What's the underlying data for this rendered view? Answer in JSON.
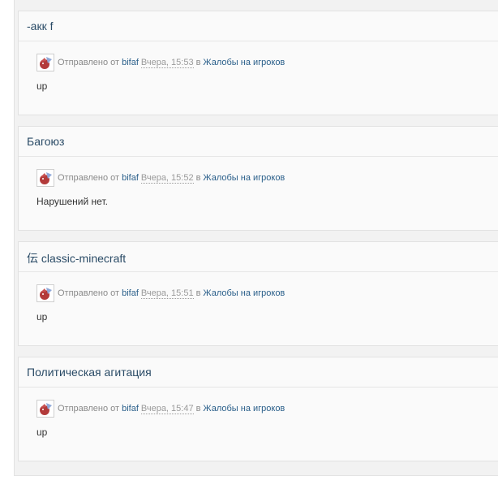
{
  "posts": [
    {
      "title": "-акк f",
      "sent_by": "Отправлено от",
      "author": "bifaf",
      "date": "Вчера, 15:53",
      "in_word": "в",
      "forum": "Жалобы на игроков",
      "body": "up"
    },
    {
      "title": "Багоюз",
      "sent_by": "Отправлено от",
      "author": "bifaf",
      "date": "Вчера, 15:52",
      "in_word": "в",
      "forum": "Жалобы на игроков",
      "body": "Нарушений нет."
    },
    {
      "title": "伝 classic-minecraft",
      "sent_by": "Отправлено от",
      "author": "bifaf",
      "date": "Вчера, 15:51",
      "in_word": "в",
      "forum": "Жалобы на игроков",
      "body": "up"
    },
    {
      "title": "Политическая агитация",
      "sent_by": "Отправлено от",
      "author": "bifaf",
      "date": "Вчера, 15:47",
      "in_word": "в",
      "forum": "Жалобы на игроков",
      "body": "up"
    }
  ],
  "colors": {
    "title": "#2a4b66",
    "link": "#2a5f8a",
    "meta_text": "#8a8a8a"
  },
  "icons": {
    "avatar": "user-avatar-icon"
  }
}
